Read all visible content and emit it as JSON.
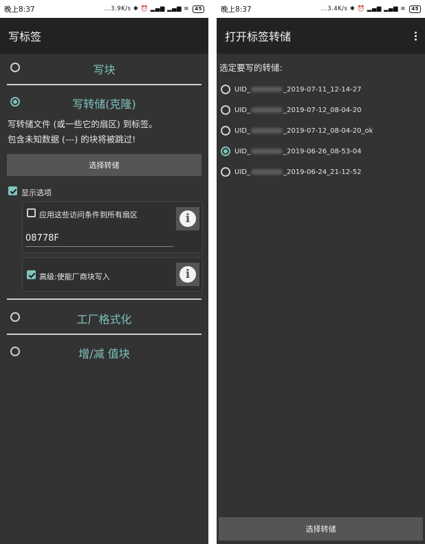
{
  "left": {
    "status": {
      "time": "晚上8:37",
      "net": "...3.9K/s",
      "battery": "45"
    },
    "title": "写标签",
    "sections": {
      "write_block": "写块",
      "write_dump": "写转储(克隆)",
      "factory_format": "工厂格式化",
      "value_block": "增/减 值块"
    },
    "desc_line1": "写转储文件 (或一些它的扇区) 到标签。",
    "desc_line2": "包含未知数据 (---) 的块将被跳过!",
    "choose_dump_button": "选择转储",
    "show_options_label": "显示选项",
    "apply_acl_label": "应用这些访问条件到所有扇区",
    "acl_value": "08778F",
    "advanced_label": "高级:使能厂商块写入"
  },
  "right": {
    "status": {
      "time": "晚上8:37",
      "net": "...3.4K/s",
      "battery": "45"
    },
    "title": "打开标签转储",
    "heading": "选定要写的转储:",
    "dumps": [
      {
        "prefix": "UID_",
        "suffix": "_2019-07-11_12-14-27",
        "selected": false
      },
      {
        "prefix": "UID_",
        "suffix": "_2019-07-12_08-04-20",
        "selected": false
      },
      {
        "prefix": "UID_",
        "suffix": "_2019-07-12_08-04-20_ok",
        "selected": false
      },
      {
        "prefix": "UID_",
        "suffix": "_2019-06-26_08-53-04",
        "selected": true
      },
      {
        "prefix": "UID_",
        "suffix": "_2019-06-24_21-12-52",
        "selected": false
      }
    ],
    "choose_dump_button": "选择转储"
  },
  "accent_color": "#7ec3bd"
}
